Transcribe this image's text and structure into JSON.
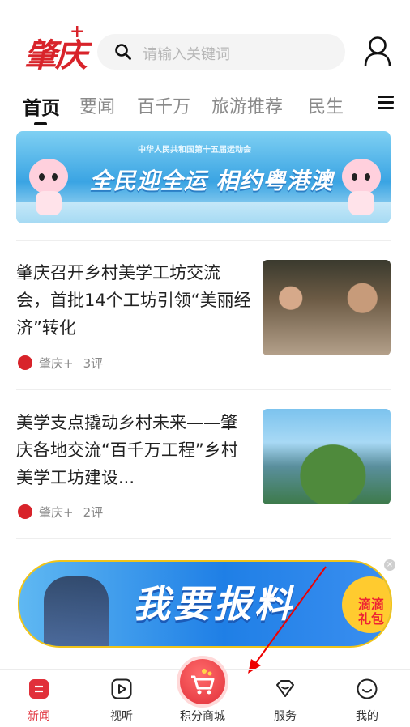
{
  "header": {
    "logo_text": "肇庆",
    "logo_plus": "+",
    "search_placeholder": "请输入关键词"
  },
  "tabs": [
    {
      "label": "首页",
      "active": true
    },
    {
      "label": "要闻",
      "active": false
    },
    {
      "label": "百千万",
      "active": false
    },
    {
      "label": "旅游推荐",
      "active": false
    },
    {
      "label": "民生",
      "active": false
    }
  ],
  "banner_top": {
    "subtitle": "中华人民共和国第十五届运动会",
    "headline": "全民迎全运  相约粤港澳"
  },
  "news": [
    {
      "title": "肇庆召开乡村美学工坊交流会，首批14个工坊引领“美丽经济”转化",
      "source": "肇庆+",
      "comments": "3评"
    },
    {
      "title": "美学支点撬动乡村未来——肇庆各地交流“百千万工程”乡村美学工坊建设...",
      "source": "肇庆+",
      "comments": "2评"
    }
  ],
  "banner_ad": {
    "headline": "我要报料",
    "badge": "滴滴礼包"
  },
  "bottom_nav": [
    {
      "label": "新闻",
      "active": true,
      "icon": "news-icon"
    },
    {
      "label": "视听",
      "active": false,
      "icon": "video-icon"
    },
    {
      "label": "积分商城",
      "active": false,
      "icon": "cart-icon"
    },
    {
      "label": "服务",
      "active": false,
      "icon": "service-icon"
    },
    {
      "label": "我的",
      "active": false,
      "icon": "smile-icon"
    }
  ],
  "colors": {
    "brand_red": "#d8232a",
    "active_tab": "#111111",
    "inactive_tab": "#8a8a8a"
  }
}
